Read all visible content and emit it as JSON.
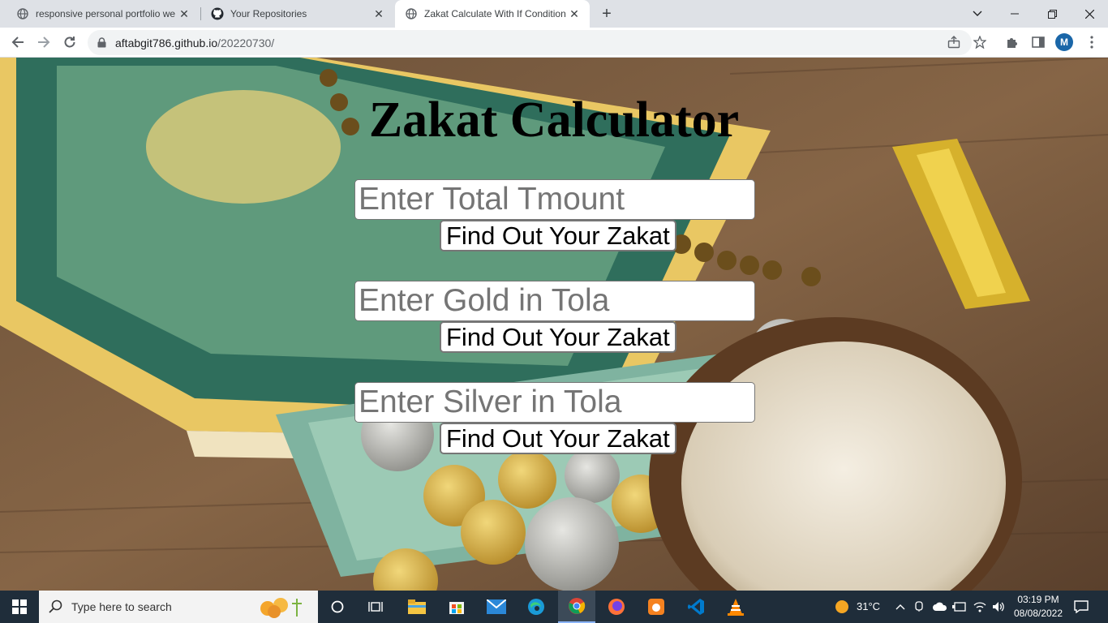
{
  "browser": {
    "tabs": [
      {
        "title": "responsive personal portfolio we",
        "active": false
      },
      {
        "title": "Your Repositories",
        "active": false
      },
      {
        "title": "Zakat Calculate With If Condition",
        "active": true
      }
    ],
    "url_domain": "aftabgit786.github.io",
    "url_path": "/20220730/",
    "profile_initial": "M"
  },
  "page": {
    "title": "Zakat Calculator",
    "fields": [
      {
        "placeholder": "Enter Total Tmount",
        "button": "Find Out Your Zakat"
      },
      {
        "placeholder": "Enter Gold in Tola",
        "button": "Find Out Your Zakat"
      },
      {
        "placeholder": "Enter Silver in Tola",
        "button": "Find Out Your Zakat"
      }
    ]
  },
  "taskbar": {
    "search_placeholder": "Type here to search",
    "weather": "31°C",
    "time": "03:19 PM",
    "date": "08/08/2022"
  },
  "colors": {
    "tabstrip": "#dee1e6",
    "taskbar": "#1f2d3a",
    "avatar": "#1a66a8"
  }
}
